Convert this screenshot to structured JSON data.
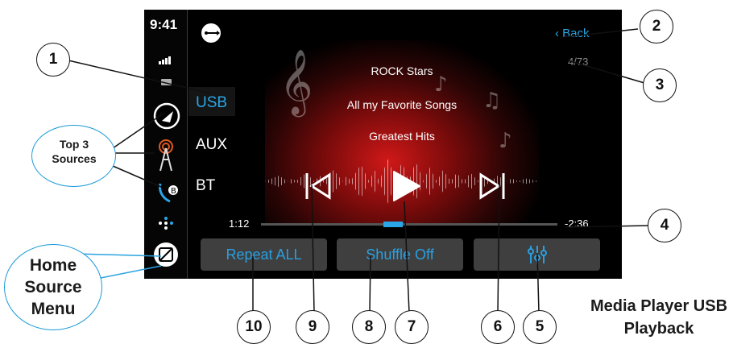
{
  "status_bar": {
    "time": "9:41"
  },
  "sources": [
    {
      "label": "USB",
      "active": true
    },
    {
      "label": "AUX",
      "active": false
    },
    {
      "label": "BT",
      "active": false
    }
  ],
  "track_info": {
    "artist": "ROCK Stars",
    "album": "All my Favorite Songs",
    "title": "Greatest Hits"
  },
  "navigation": {
    "back_label": "Back",
    "track_count": "4/73"
  },
  "playback": {
    "elapsed": "1:12",
    "remaining": "-2:36",
    "progress_fraction": 0.46
  },
  "buttons": {
    "repeat_label": "Repeat ALL",
    "shuffle_label": "Shuffle Off",
    "eq_icon": "equalizer-icon"
  },
  "side_icons": [
    "usb-icon",
    "play-source-icon",
    "radio-tower-icon",
    "bluetooth-phone-icon",
    "app-dots-icon",
    "home-source-menu-icon"
  ],
  "colors": {
    "accent": "#29a6e8",
    "screen_bg": "#000000",
    "button_bg": "#3f3f3f"
  },
  "annotations": {
    "top3_label": "Top 3 Sources",
    "home_label": "Home Source Menu",
    "caption": "Media Player USB Playback",
    "callouts": [
      "1",
      "2",
      "3",
      "4",
      "5",
      "6",
      "7",
      "8",
      "9",
      "10"
    ]
  }
}
